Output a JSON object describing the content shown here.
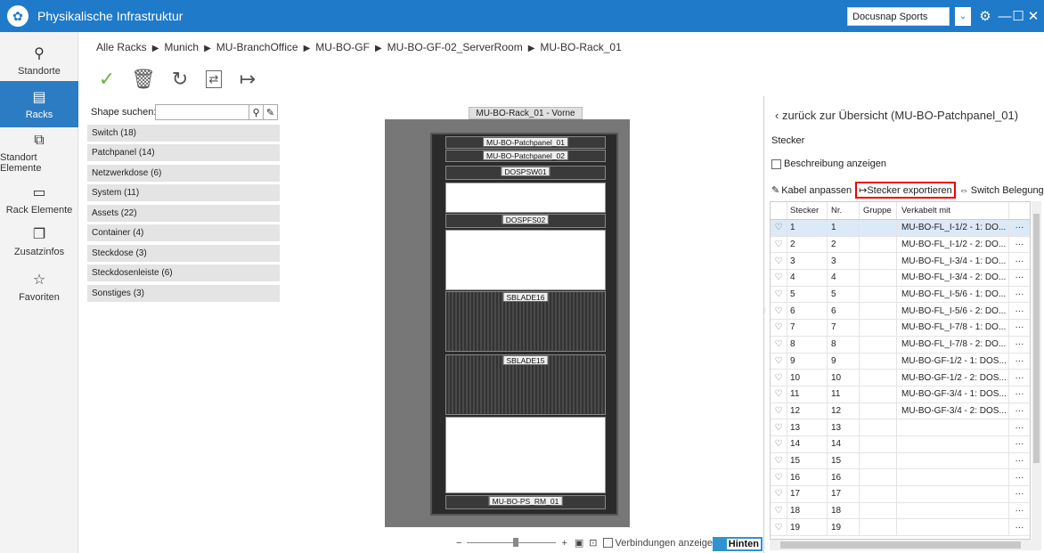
{
  "title_bar": {
    "title": "Physikalische Infrastruktur",
    "profile": "Docusnap Sports",
    "settings_icon": "gear-icon",
    "minimize": "—",
    "maximize": "☐",
    "close": "✕"
  },
  "nav": [
    {
      "label": "Standorte",
      "icon": "location-pin-icon"
    },
    {
      "label": "Racks",
      "icon": "rack-icon"
    },
    {
      "label": "Standort Elemente",
      "icon": "site-elements-icon"
    },
    {
      "label": "Rack Elemente",
      "icon": "rack-elements-icon"
    },
    {
      "label": "Zusatzinfos",
      "icon": "additional-info-icon"
    },
    {
      "label": "Favoriten",
      "icon": "star-icon"
    }
  ],
  "breadcrumb": [
    "Alle Racks",
    "Munich",
    "MU-BranchOffice",
    "MU-BO-GF",
    "MU-BO-GF-02_ServerRoom",
    "MU-BO-Rack_01"
  ],
  "shape_panel": {
    "search_label": "Shape suchen:",
    "search_value": "",
    "categories": [
      "Switch (18)",
      "Patchpanel (14)",
      "Netzwerkdose (6)",
      "System (11)",
      "Assets (22)",
      "Container (4)",
      "Steckdose (3)",
      "Steckdosenleiste (6)",
      "Sonstiges (3)"
    ]
  },
  "rack": {
    "title": "MU-BO-Rack_01 - Vorne",
    "units": [
      "MU-BO-Patchpanel_01",
      "MU-BO-Patchpanel_02",
      "DOSPSW01",
      "DOSPFS02",
      "SBLADE16",
      "SBLADE15",
      "MU-BO-PS_RM_01"
    ]
  },
  "zoom": {
    "minus": "−",
    "plus": "+",
    "show_connections": "Verbindungen anzeigen",
    "back_label": "Hinten"
  },
  "detail": {
    "back_link": "zurück zur Übersicht (MU-BO-Patchpanel_01)",
    "heading": "Stecker",
    "show_description": "Beschreibung anzeigen",
    "actions": {
      "adjust_cable": "Kabel anpassen",
      "export_plugs": "Stecker exportieren",
      "switch_assignment": "Switch Belegung"
    },
    "columns": [
      "Stecker",
      "Nr.",
      "Gruppe",
      "Verkabelt mit"
    ],
    "rows": [
      {
        "stecker": "1",
        "nr": "1",
        "gruppe": "",
        "verkabelt": "MU-BO-FL_I-1/2 - 1: DO..."
      },
      {
        "stecker": "2",
        "nr": "2",
        "gruppe": "",
        "verkabelt": "MU-BO-FL_I-1/2 - 2: DO..."
      },
      {
        "stecker": "3",
        "nr": "3",
        "gruppe": "",
        "verkabelt": "MU-BO-FL_I-3/4 - 1: DO..."
      },
      {
        "stecker": "4",
        "nr": "4",
        "gruppe": "",
        "verkabelt": "MU-BO-FL_I-3/4 - 2: DO..."
      },
      {
        "stecker": "5",
        "nr": "5",
        "gruppe": "",
        "verkabelt": "MU-BO-FL_I-5/6 - 1: DO..."
      },
      {
        "stecker": "6",
        "nr": "6",
        "gruppe": "",
        "verkabelt": "MU-BO-FL_I-5/6 - 2: DO..."
      },
      {
        "stecker": "7",
        "nr": "7",
        "gruppe": "",
        "verkabelt": "MU-BO-FL_I-7/8 - 1: DO..."
      },
      {
        "stecker": "8",
        "nr": "8",
        "gruppe": "",
        "verkabelt": "MU-BO-FL_I-7/8 - 2: DO..."
      },
      {
        "stecker": "9",
        "nr": "9",
        "gruppe": "",
        "verkabelt": "MU-BO-GF-1/2 - 1: DOS..."
      },
      {
        "stecker": "10",
        "nr": "10",
        "gruppe": "",
        "verkabelt": "MU-BO-GF-1/2 - 2: DOS..."
      },
      {
        "stecker": "11",
        "nr": "11",
        "gruppe": "",
        "verkabelt": "MU-BO-GF-3/4 - 1: DOS..."
      },
      {
        "stecker": "12",
        "nr": "12",
        "gruppe": "",
        "verkabelt": "MU-BO-GF-3/4 - 2: DOS..."
      },
      {
        "stecker": "13",
        "nr": "13",
        "gruppe": "",
        "verkabelt": ""
      },
      {
        "stecker": "14",
        "nr": "14",
        "gruppe": "",
        "verkabelt": ""
      },
      {
        "stecker": "15",
        "nr": "15",
        "gruppe": "",
        "verkabelt": ""
      },
      {
        "stecker": "16",
        "nr": "16",
        "gruppe": "",
        "verkabelt": ""
      },
      {
        "stecker": "17",
        "nr": "17",
        "gruppe": "",
        "verkabelt": ""
      },
      {
        "stecker": "18",
        "nr": "18",
        "gruppe": "",
        "verkabelt": ""
      },
      {
        "stecker": "19",
        "nr": "19",
        "gruppe": "",
        "verkabelt": ""
      }
    ],
    "more": "···"
  }
}
